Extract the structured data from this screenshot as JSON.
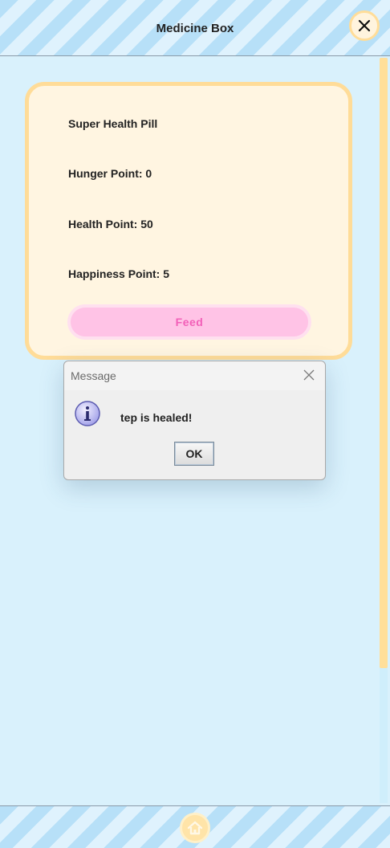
{
  "header": {
    "title": "Medicine Box",
    "close_icon": "close-icon"
  },
  "card": {
    "item_name": "Super Health Pill",
    "hunger": "Hunger Point: 0",
    "health": "Health Point: 50",
    "happiness": "Happiness Point: 5",
    "feed_label": "Feed"
  },
  "dialog": {
    "title": "Message",
    "message": "tep is healed!",
    "ok_label": "OK",
    "icon": "info-icon"
  },
  "footer": {
    "home_icon": "home-icon"
  },
  "colors": {
    "background": "#d9f1fc",
    "card_fill": "#fff5e1",
    "card_border": "#ffdc98",
    "feed_button": "#ffc3e6",
    "feed_text": "#f25fb8",
    "scroll_thumb": "#ffdf9a"
  }
}
